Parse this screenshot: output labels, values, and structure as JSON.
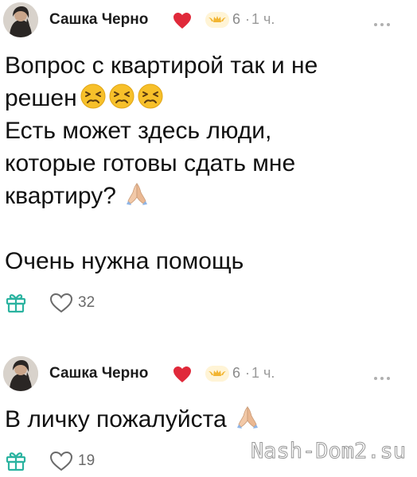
{
  "posts": [
    {
      "author": "Сашка Черно",
      "level": "6",
      "separator": "·",
      "time": "1 ч.",
      "text_lines": [
        "Вопрос с квартирой так и не",
        "решен",
        "Есть может здесь люди,",
        "которые готовы сдать мне",
        "квартиру?",
        "",
        "Очень нужна помощь"
      ],
      "likes": "32"
    },
    {
      "author": "Сашка Черно",
      "level": "6",
      "separator": "·",
      "time": "1 ч.",
      "text_lines": [
        "В личку пожалуйста"
      ],
      "likes": "19"
    }
  ],
  "icons": {
    "heart": "heart-icon",
    "level": "crown-wings-icon",
    "more": "more-dots-icon",
    "gift": "gift-icon",
    "like": "heart-outline-icon",
    "persevering_face": "persevering-face-emoji",
    "folded_hands": "folded-hands-emoji"
  },
  "colors": {
    "accent_teal": "#2bb3a0",
    "heart_red": "#e0293a",
    "badge_gold": "#f2b531"
  },
  "watermark": "Nash-Dom2.su"
}
